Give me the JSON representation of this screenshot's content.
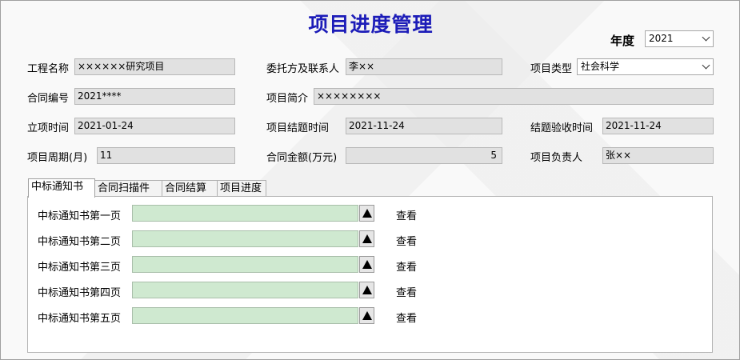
{
  "title": "项目进度管理",
  "year": {
    "label": "年度",
    "value": "2021"
  },
  "form": {
    "project_name": {
      "label": "工程名称",
      "value": "××××××研究项目"
    },
    "client": {
      "label": "委托方及联系人",
      "value": "李××"
    },
    "project_type": {
      "label": "项目类型",
      "value": "社会科学"
    },
    "contract_no": {
      "label": "合同编号",
      "value": "2021****"
    },
    "summary": {
      "label": "项目简介",
      "value": "××××××××"
    },
    "start_date": {
      "label": "立项时间",
      "value": "2021-01-24"
    },
    "close_date": {
      "label": "项目结题时间",
      "value": "2021-11-24"
    },
    "accept_date": {
      "label": "结题验收时间",
      "value": "2021-11-24"
    },
    "period": {
      "label": "项目周期(月)",
      "value": "11"
    },
    "amount": {
      "label": "合同金额(万元)",
      "value": "5"
    },
    "owner": {
      "label": "项目负责人",
      "value": "张××"
    }
  },
  "tabs": [
    {
      "label": "中标通知书"
    },
    {
      "label": "合同扫描件"
    },
    {
      "label": "合同结算"
    },
    {
      "label": "项目进度"
    }
  ],
  "upload_rows": [
    {
      "label": "中标通知书第一页",
      "action": "查看"
    },
    {
      "label": "中标通知书第二页",
      "action": "查看"
    },
    {
      "label": "中标通知书第三页",
      "action": "查看"
    },
    {
      "label": "中标通知书第四页",
      "action": "查看"
    },
    {
      "label": "中标通知书第五页",
      "action": "查看"
    }
  ],
  "colors": {
    "title": "#1c1cb8",
    "field_bg": "#e1e1e1",
    "upload_field_bg": "#cfe9d0"
  }
}
